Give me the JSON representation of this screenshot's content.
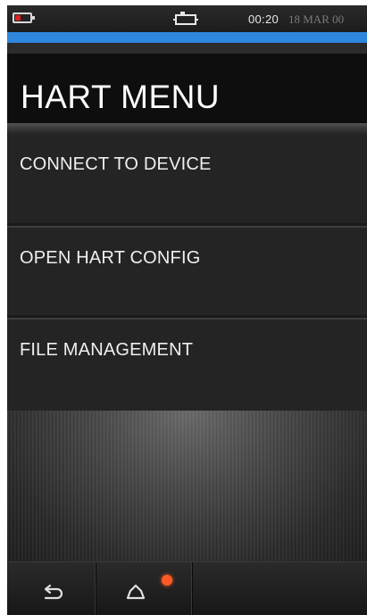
{
  "status_bar": {
    "battery_icon": "battery-low-icon",
    "connection_icon": "device-connection-icon",
    "time": "00:20",
    "date": "18 MAR 00"
  },
  "colors": {
    "accent": "#2f86dd",
    "battery_low": "#e02020",
    "notification": "#ff5a26"
  },
  "page": {
    "title": "HART MENU"
  },
  "menu": {
    "items": [
      {
        "label": "CONNECT TO DEVICE"
      },
      {
        "label": "OPEN HART CONFIG"
      },
      {
        "label": "FILE MANAGEMENT"
      }
    ]
  },
  "nav_bar": {
    "back_icon": "back-arrow-icon",
    "home_icon": "home-icon",
    "home_has_notification": true
  }
}
